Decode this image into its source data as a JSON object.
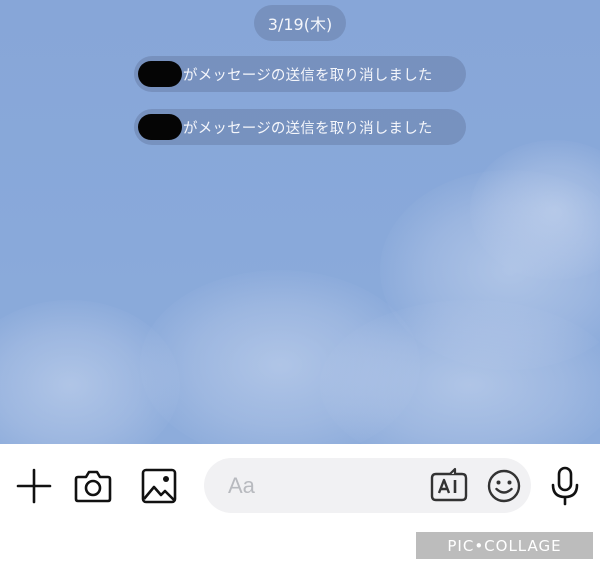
{
  "chat": {
    "date_label": "3/19(木)",
    "system_messages": [
      {
        "text": "がメッセージの送信を取り消しました"
      },
      {
        "text": "がメッセージの送信を取り消しました"
      }
    ]
  },
  "input_bar": {
    "placeholder": "Aa",
    "icons": [
      "plus-icon",
      "camera-icon",
      "image-icon",
      "ai-icon",
      "emoji-icon",
      "mic-icon"
    ]
  },
  "watermark": {
    "text": "PIC•COLLAGE"
  },
  "colors": {
    "chat_background": "#89a9da",
    "pill_background": "#697faa",
    "redaction": "#050505",
    "input_field": "#f1f1f3",
    "watermark_background": "#bcbcbc"
  }
}
